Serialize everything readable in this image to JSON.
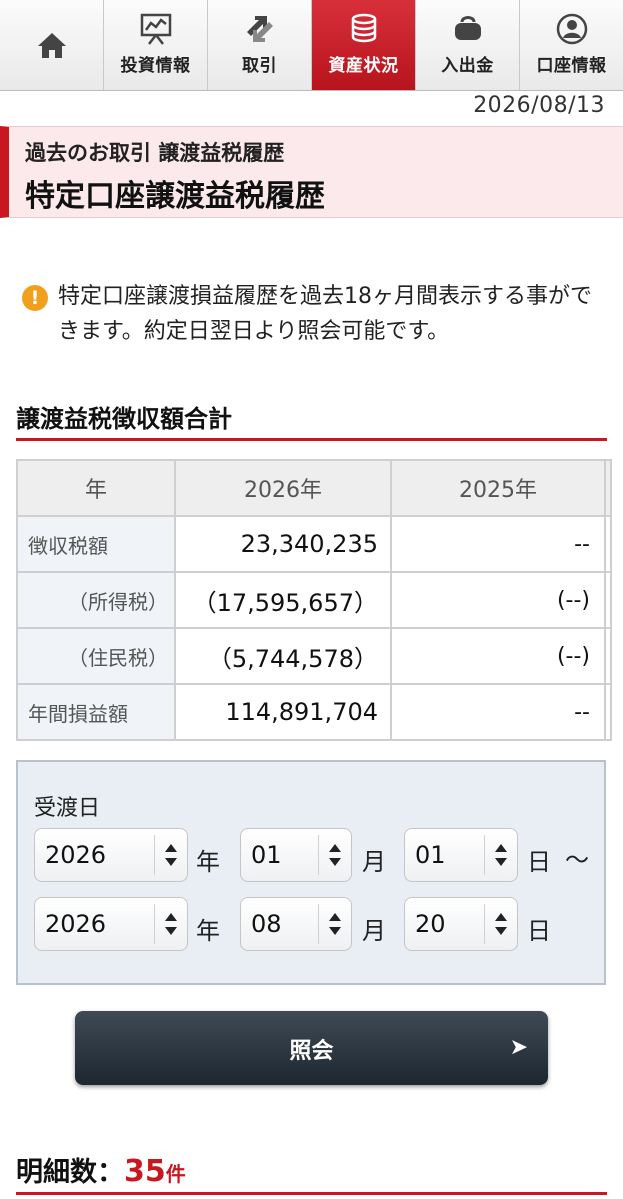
{
  "nav": {
    "home_icon": "home-icon",
    "tabs": [
      {
        "label": "投資情報",
        "icon": "chart-board-icon"
      },
      {
        "label": "取引",
        "icon": "trade-arrows-icon"
      },
      {
        "label": "資産状況",
        "icon": "coin-stack-icon",
        "active": true
      },
      {
        "label": "入出金",
        "icon": "wallet-icon"
      },
      {
        "label": "口座情報",
        "icon": "user-icon"
      }
    ]
  },
  "date": "2026/08/13",
  "header": {
    "breadcrumb": "過去のお取引 譲渡益税履歴",
    "title": "特定口座譲渡益税履歴"
  },
  "notice": {
    "icon": "exclamation-icon",
    "text": "特定口座譲渡損益履歴を過去18ヶ月間表示する事ができます。約定日翌日より照会可能です。"
  },
  "summary": {
    "heading": "譲渡益税徴収額合計",
    "columns": [
      "年",
      "2026年",
      "2025年"
    ],
    "rows": [
      {
        "label": "徴収税額",
        "v2026": "23,340,235",
        "v2025": "--"
      },
      {
        "label": "（所得税）",
        "v2026": "（17,595,657）",
        "v2025": "(--)"
      },
      {
        "label": "（住民税）",
        "v2026": "（5,744,578）",
        "v2025": "(--)"
      },
      {
        "label": "年間損益額",
        "v2026": "114,891,704",
        "v2025": "--"
      }
    ]
  },
  "form": {
    "label": "受渡日",
    "from": {
      "year": "2026",
      "month": "01",
      "day": "01"
    },
    "to": {
      "year": "2026",
      "month": "08",
      "day": "20"
    },
    "unit_year": "年",
    "unit_month": "月",
    "unit_day": "日",
    "range_sep": "〜"
  },
  "submit": {
    "label": "照会",
    "arrow": "➤"
  },
  "results": {
    "label": "明細数：",
    "count": "35",
    "unit": "件"
  },
  "colors": {
    "accent": "#c8171f",
    "title_bg": "#fbe9ec",
    "button": "#26303a"
  }
}
